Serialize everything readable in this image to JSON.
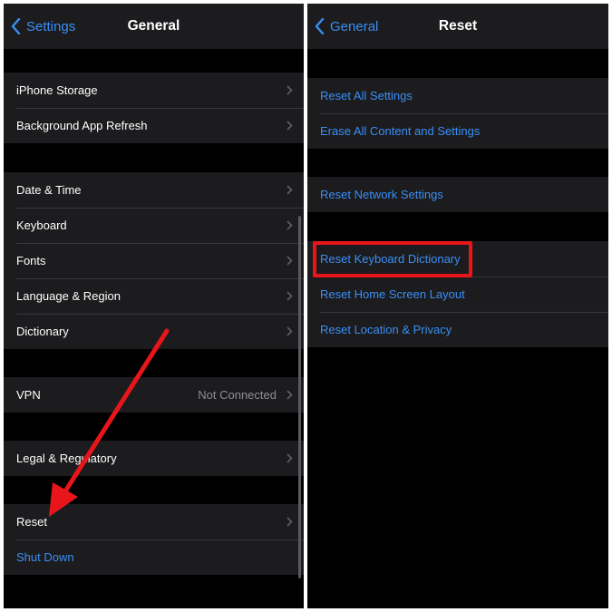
{
  "left_screen": {
    "back_label": "Settings",
    "title": "General",
    "groups": [
      [
        {
          "label": "iPhone Storage"
        },
        {
          "label": "Background App Refresh"
        }
      ],
      [
        {
          "label": "Date & Time"
        },
        {
          "label": "Keyboard"
        },
        {
          "label": "Fonts"
        },
        {
          "label": "Language & Region"
        },
        {
          "label": "Dictionary"
        }
      ],
      [
        {
          "label": "VPN",
          "value": "Not Connected"
        }
      ],
      [
        {
          "label": "Legal & Regulatory"
        }
      ],
      [
        {
          "label": "Reset"
        },
        {
          "label": "Shut Down"
        }
      ]
    ]
  },
  "right_screen": {
    "back_label": "General",
    "title": "Reset",
    "groups": [
      [
        {
          "label": "Reset All Settings"
        },
        {
          "label": "Erase All Content and Settings"
        }
      ],
      [
        {
          "label": "Reset Network Settings"
        }
      ],
      [
        {
          "label": "Reset Keyboard Dictionary"
        },
        {
          "label": "Reset Home Screen Layout"
        },
        {
          "label": "Reset Location & Privacy"
        }
      ]
    ]
  },
  "colors": {
    "accent_blue": "#3a8ef6",
    "annotation_red": "#e8161b",
    "cell_background": "#1c1c1e"
  },
  "icons": [
    "chevron-left-icon",
    "chevron-right-icon",
    "red-arrow-annotation"
  ]
}
